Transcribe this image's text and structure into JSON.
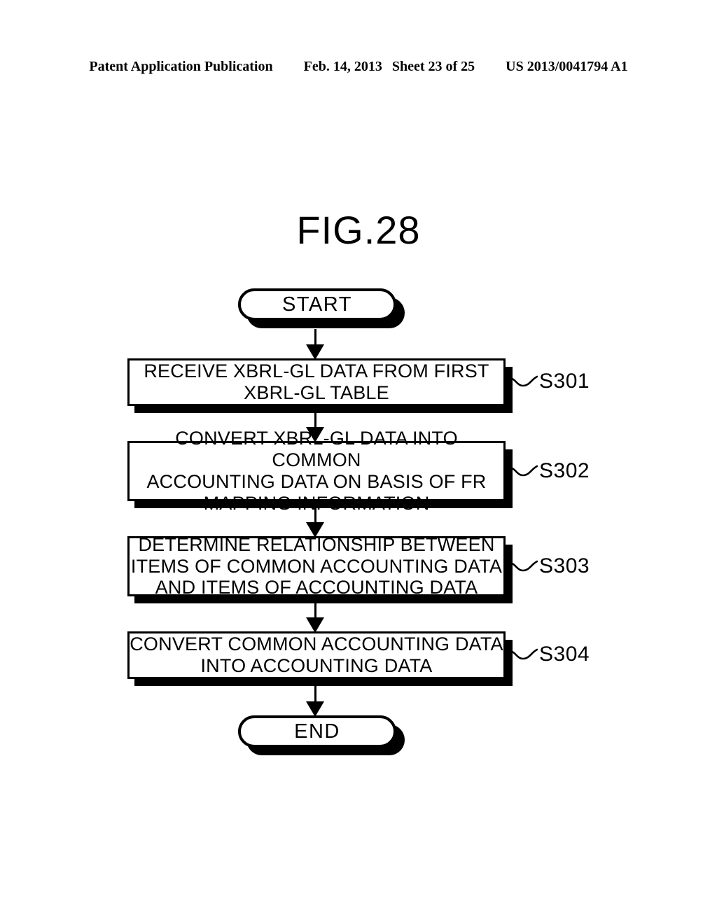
{
  "header": {
    "publication": "Patent Application Publication",
    "date": "Feb. 14, 2013",
    "sheet": "Sheet 23 of 25",
    "patent_number": "US 2013/0041794 A1"
  },
  "figure": {
    "title": "FIG.28"
  },
  "flowchart": {
    "type": "flowchart",
    "orientation": "top-to-bottom",
    "start": {
      "label": "START",
      "shape": "terminator"
    },
    "end": {
      "label": "END",
      "shape": "terminator"
    },
    "steps": [
      {
        "id": "S301",
        "shape": "process",
        "text": "RECEIVE XBRL-GL DATA FROM FIRST\nXBRL-GL TABLE"
      },
      {
        "id": "S302",
        "shape": "process",
        "text": "CONVERT XBRL-GL DATA INTO COMMON\nACCOUNTING DATA ON BASIS OF FR\nMAPPING INFORMATION"
      },
      {
        "id": "S303",
        "shape": "process",
        "text": "DETERMINE RELATIONSHIP BETWEEN\nITEMS OF COMMON ACCOUNTING DATA\nAND ITEMS OF ACCOUNTING DATA"
      },
      {
        "id": "S304",
        "shape": "process",
        "text": "CONVERT COMMON ACCOUNTING DATA\nINTO ACCOUNTING DATA"
      }
    ],
    "colors": {
      "stroke": "#000000",
      "fill": "#ffffff",
      "shadow": "#000000"
    }
  }
}
